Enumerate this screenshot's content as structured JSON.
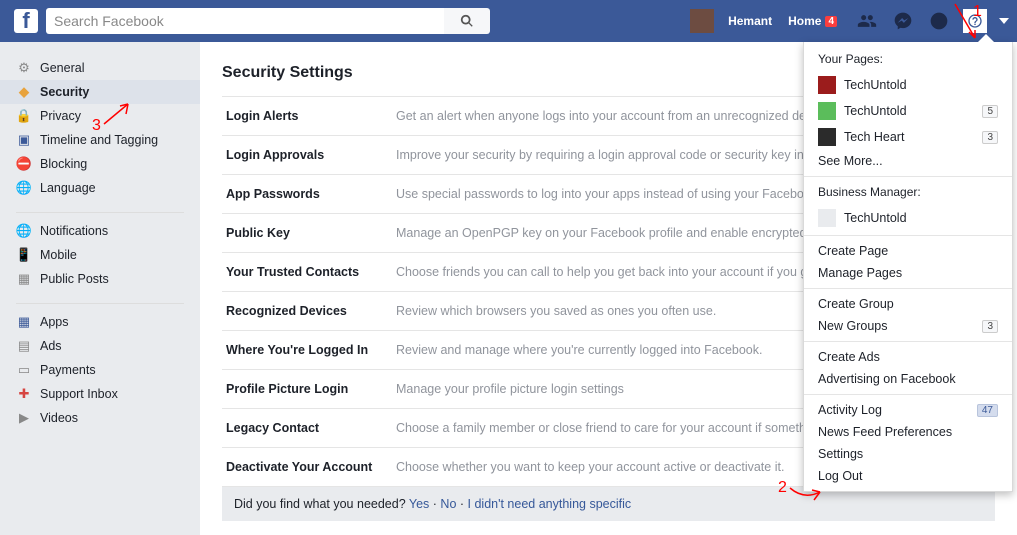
{
  "header": {
    "search_placeholder": "Search Facebook",
    "user_name": "Hemant",
    "home_label": "Home",
    "home_badge": "4"
  },
  "leftnav": {
    "group1": [
      {
        "icon": "⚙",
        "iconClass": "i-gear",
        "label": "General"
      },
      {
        "icon": "◆",
        "iconClass": "i-shield",
        "label": "Security",
        "selected": true
      },
      {
        "icon": "🔒",
        "iconClass": "i-lock",
        "label": "Privacy"
      },
      {
        "icon": "▣",
        "iconClass": "i-tag",
        "label": "Timeline and Tagging"
      },
      {
        "icon": "⛔",
        "iconClass": "i-block",
        "label": "Blocking"
      },
      {
        "icon": "🌐",
        "iconClass": "i-globe2",
        "label": "Language"
      }
    ],
    "group2": [
      {
        "icon": "🌐",
        "iconClass": "i-globe",
        "label": "Notifications"
      },
      {
        "icon": "📱",
        "iconClass": "i-mobile",
        "label": "Mobile"
      },
      {
        "icon": "▦",
        "iconClass": "i-posts",
        "label": "Public Posts"
      }
    ],
    "group3": [
      {
        "icon": "▦",
        "iconClass": "i-apps",
        "label": "Apps"
      },
      {
        "icon": "▤",
        "iconClass": "i-ads",
        "label": "Ads"
      },
      {
        "icon": "▭",
        "iconClass": "i-pay",
        "label": "Payments"
      },
      {
        "icon": "✚",
        "iconClass": "i-support",
        "label": "Support Inbox"
      },
      {
        "icon": "▶",
        "iconClass": "i-video",
        "label": "Videos"
      }
    ]
  },
  "main": {
    "title": "Security Settings",
    "rows": [
      {
        "label": "Login Alerts",
        "desc": "Get an alert when anyone logs into your account from an unrecognized de"
      },
      {
        "label": "Login Approvals",
        "desc": "Improve your security by requiring a login approval code or security key in password."
      },
      {
        "label": "App Passwords",
        "desc": "Use special passwords to log into your apps instead of using your Facebo Approvals codes."
      },
      {
        "label": "Public Key",
        "desc": "Manage an OpenPGP key on your Facebook profile and enable encrypted"
      },
      {
        "label": "Your Trusted Contacts",
        "desc": "Choose friends you can call to help you get back into your account if you g"
      },
      {
        "label": "Recognized Devices",
        "desc": "Review which browsers you saved as ones you often use."
      },
      {
        "label": "Where You're Logged In",
        "desc": "Review and manage where you're currently logged into Facebook."
      },
      {
        "label": "Profile Picture Login",
        "desc": "Manage your profile picture login settings"
      },
      {
        "label": "Legacy Contact",
        "desc": "Choose a family member or close friend to care for your account if somethi"
      },
      {
        "label": "Deactivate Your Account",
        "desc": "Choose whether you want to keep your account active or deactivate it."
      }
    ],
    "feedback": {
      "text": "Did you find what you needed?  ",
      "yes": "Yes",
      "no": "No",
      "na": "I didn't need anything specific"
    }
  },
  "dropdown": {
    "pages_title": "Your Pages:",
    "pages": [
      {
        "label": "TechUntold",
        "thumbColor": "#9b1c1c"
      },
      {
        "label": "TechUntold",
        "thumbColor": "#5bbd5b",
        "count": "5"
      },
      {
        "label": "Tech Heart",
        "thumbColor": "#2b2b2b",
        "count": "3"
      }
    ],
    "see_more": "See More...",
    "bm_title": "Business Manager:",
    "bm": [
      {
        "label": "TechUntold",
        "thumbColor": "#e9ebee"
      }
    ],
    "links1": [
      "Create Page",
      "Manage Pages"
    ],
    "links2": [
      {
        "label": "Create Group"
      },
      {
        "label": "New Groups",
        "count": "3"
      }
    ],
    "links3": [
      "Create Ads",
      "Advertising on Facebook"
    ],
    "links4": [
      {
        "label": "Activity Log",
        "count": "47",
        "countStyle": "blue"
      },
      {
        "label": "News Feed Preferences"
      },
      {
        "label": "Settings"
      },
      {
        "label": "Log Out"
      }
    ]
  },
  "annotations": {
    "a1": "1",
    "a2": "2",
    "a3": "3"
  }
}
